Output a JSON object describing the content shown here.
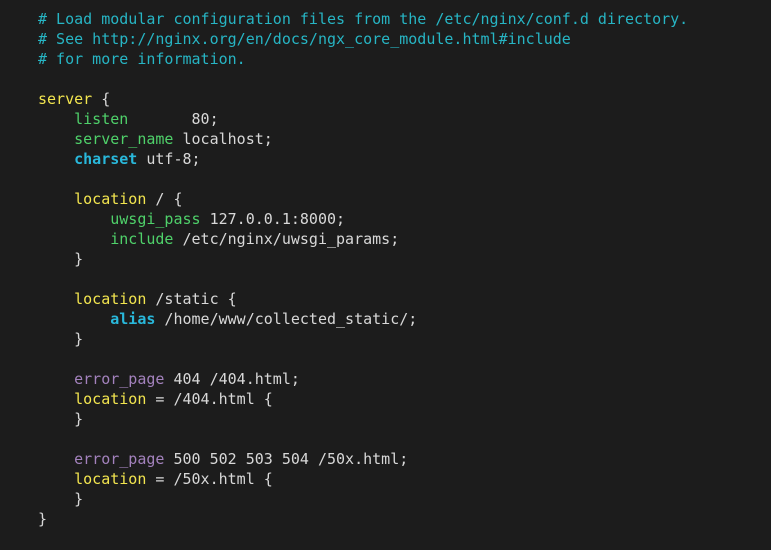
{
  "editor": {
    "background_color": "#1c1c1c",
    "language": "nginx",
    "font_size_px": 15,
    "line_height_px": 20
  },
  "palette": {
    "comment": "#27b5c4",
    "block_keyword": "#f2e54f",
    "directive": "#4fd16a",
    "special_directive": "#29b8db",
    "error_page_directive": "#a382bd",
    "value_text": "#d8d8d8",
    "background": "#1c1c1c"
  },
  "lines": [
    {
      "number": 1,
      "indent": "",
      "tokens": [
        {
          "text": "# Load modular configuration files from the /etc/nginx/conf.d directory.",
          "type": "comment"
        }
      ]
    },
    {
      "number": 2,
      "indent": "",
      "tokens": [
        {
          "text": "# See http://nginx.org/en/docs/ngx_core_module.html#include",
          "type": "comment"
        }
      ]
    },
    {
      "number": 3,
      "indent": "",
      "tokens": [
        {
          "text": "# for more information.",
          "type": "comment"
        }
      ]
    },
    {
      "number": 4,
      "indent": "",
      "tokens": []
    },
    {
      "number": 5,
      "indent": "",
      "tokens": [
        {
          "text": "server",
          "type": "block"
        },
        {
          "text": " {",
          "type": "punct"
        }
      ]
    },
    {
      "number": 6,
      "indent": "    ",
      "tokens": [
        {
          "text": "listen",
          "type": "directive"
        },
        {
          "text": "       80;",
          "type": "value"
        }
      ]
    },
    {
      "number": 7,
      "indent": "    ",
      "tokens": [
        {
          "text": "server_name",
          "type": "directive"
        },
        {
          "text": " localhost;",
          "type": "value"
        }
      ]
    },
    {
      "number": 8,
      "indent": "    ",
      "tokens": [
        {
          "text": "charset",
          "type": "special"
        },
        {
          "text": " utf-8;",
          "type": "value"
        }
      ]
    },
    {
      "number": 9,
      "indent": "",
      "tokens": []
    },
    {
      "number": 10,
      "indent": "    ",
      "tokens": [
        {
          "text": "location",
          "type": "block"
        },
        {
          "text": " / {",
          "type": "punct"
        }
      ]
    },
    {
      "number": 11,
      "indent": "        ",
      "tokens": [
        {
          "text": "uwsgi_pass",
          "type": "directive"
        },
        {
          "text": " 127.0.0.1:8000;",
          "type": "value"
        }
      ]
    },
    {
      "number": 12,
      "indent": "        ",
      "tokens": [
        {
          "text": "include",
          "type": "directive"
        },
        {
          "text": " /etc/nginx/uwsgi_params;",
          "type": "value"
        }
      ]
    },
    {
      "number": 13,
      "indent": "    ",
      "tokens": [
        {
          "text": "}",
          "type": "punct"
        }
      ]
    },
    {
      "number": 14,
      "indent": "",
      "tokens": []
    },
    {
      "number": 15,
      "indent": "    ",
      "tokens": [
        {
          "text": "location",
          "type": "block"
        },
        {
          "text": " /static {",
          "type": "punct"
        }
      ]
    },
    {
      "number": 16,
      "indent": "        ",
      "tokens": [
        {
          "text": "alias",
          "type": "special"
        },
        {
          "text": " /home/www/collected_static/;",
          "type": "value"
        }
      ]
    },
    {
      "number": 17,
      "indent": "    ",
      "tokens": [
        {
          "text": "}",
          "type": "punct"
        }
      ]
    },
    {
      "number": 18,
      "indent": "",
      "tokens": []
    },
    {
      "number": 19,
      "indent": "    ",
      "tokens": [
        {
          "text": "error_page",
          "type": "errpage"
        },
        {
          "text": " 404 /404.html;",
          "type": "value"
        }
      ]
    },
    {
      "number": 20,
      "indent": "    ",
      "tokens": [
        {
          "text": "location",
          "type": "block"
        },
        {
          "text": " = /404.html {",
          "type": "punct"
        }
      ]
    },
    {
      "number": 21,
      "indent": "    ",
      "tokens": [
        {
          "text": "}",
          "type": "punct"
        }
      ]
    },
    {
      "number": 22,
      "indent": "",
      "tokens": []
    },
    {
      "number": 23,
      "indent": "    ",
      "tokens": [
        {
          "text": "error_page",
          "type": "errpage"
        },
        {
          "text": " 500 502 503 504 /50x.html;",
          "type": "value"
        }
      ]
    },
    {
      "number": 24,
      "indent": "    ",
      "tokens": [
        {
          "text": "location",
          "type": "block"
        },
        {
          "text": " = /50x.html {",
          "type": "punct"
        }
      ]
    },
    {
      "number": 25,
      "indent": "    ",
      "tokens": [
        {
          "text": "}",
          "type": "punct"
        }
      ]
    },
    {
      "number": 26,
      "indent": "",
      "tokens": [
        {
          "text": "}",
          "type": "punct"
        }
      ]
    }
  ]
}
